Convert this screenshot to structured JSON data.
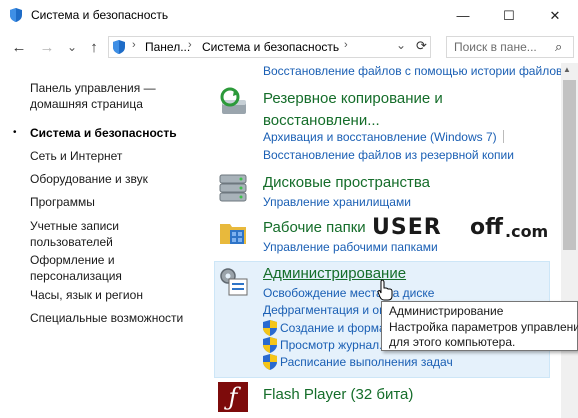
{
  "window": {
    "title": "Система и безопасность",
    "min_glyph": "—",
    "max_glyph": "☐",
    "close_glyph": "✕"
  },
  "nav": {
    "back": "←",
    "forward": "→",
    "recent": "⌄",
    "up": "↑",
    "crumbs": [
      "Панел...",
      "Система и безопасность"
    ],
    "sep": "›",
    "dropdown": "⌄",
    "refresh": "⟳",
    "search_placeholder": "Поиск в пане...",
    "search_glyph": "⌕"
  },
  "left": {
    "home_line1": "Панель управления —",
    "home_line2": "домашняя страница",
    "current": "Система и безопасность",
    "items": [
      "Сеть и Интернет",
      "Оборудование и звук",
      "Программы"
    ],
    "accounts_line1": "Учетные записи",
    "accounts_line2": "пользователей",
    "appearance_line1": "Оформление и",
    "appearance_line2": "персонализация",
    "clock": "Часы, язык и регион",
    "access": "Специальные возможности",
    "bullet": "•"
  },
  "main": {
    "top_link": "Восстановление файлов с помощью истории файлов",
    "backup": {
      "title_line1": "Резервное копирование и",
      "title_line2": "восстановлени...",
      "link1": "Архивация и восстановление (Windows 7)",
      "link2": "Восстановление файлов из резервной копии"
    },
    "storage": {
      "title": "Дисковые пространства",
      "link1": "Управление хранилищами"
    },
    "work": {
      "title": "Рабочие папки",
      "link1": "Управление рабочими папками"
    },
    "admin": {
      "title": "Администрирование",
      "link1": "Освобождение места на диске",
      "link2": "Дефрагментация и оптимиз...",
      "link3": "Создание и форма...",
      "link4": "Просмотр журнал...",
      "link5": "Расписание выполнения задач"
    },
    "flash": {
      "title": "Flash Player (32 бита)",
      "icon_glyph": "ƒ"
    }
  },
  "tooltip": {
    "line1": "Администрирование",
    "line2": "Настройка параметров управления",
    "line3": "для этого компьютера."
  },
  "watermark": {
    "user": "USER",
    "off": "off",
    "com": ".com"
  },
  "scroll": {
    "up": "▲"
  },
  "colors": {
    "title_green": "#156d2a",
    "link_blue": "#1a5fb4",
    "highlight": "#e5f1fb"
  }
}
